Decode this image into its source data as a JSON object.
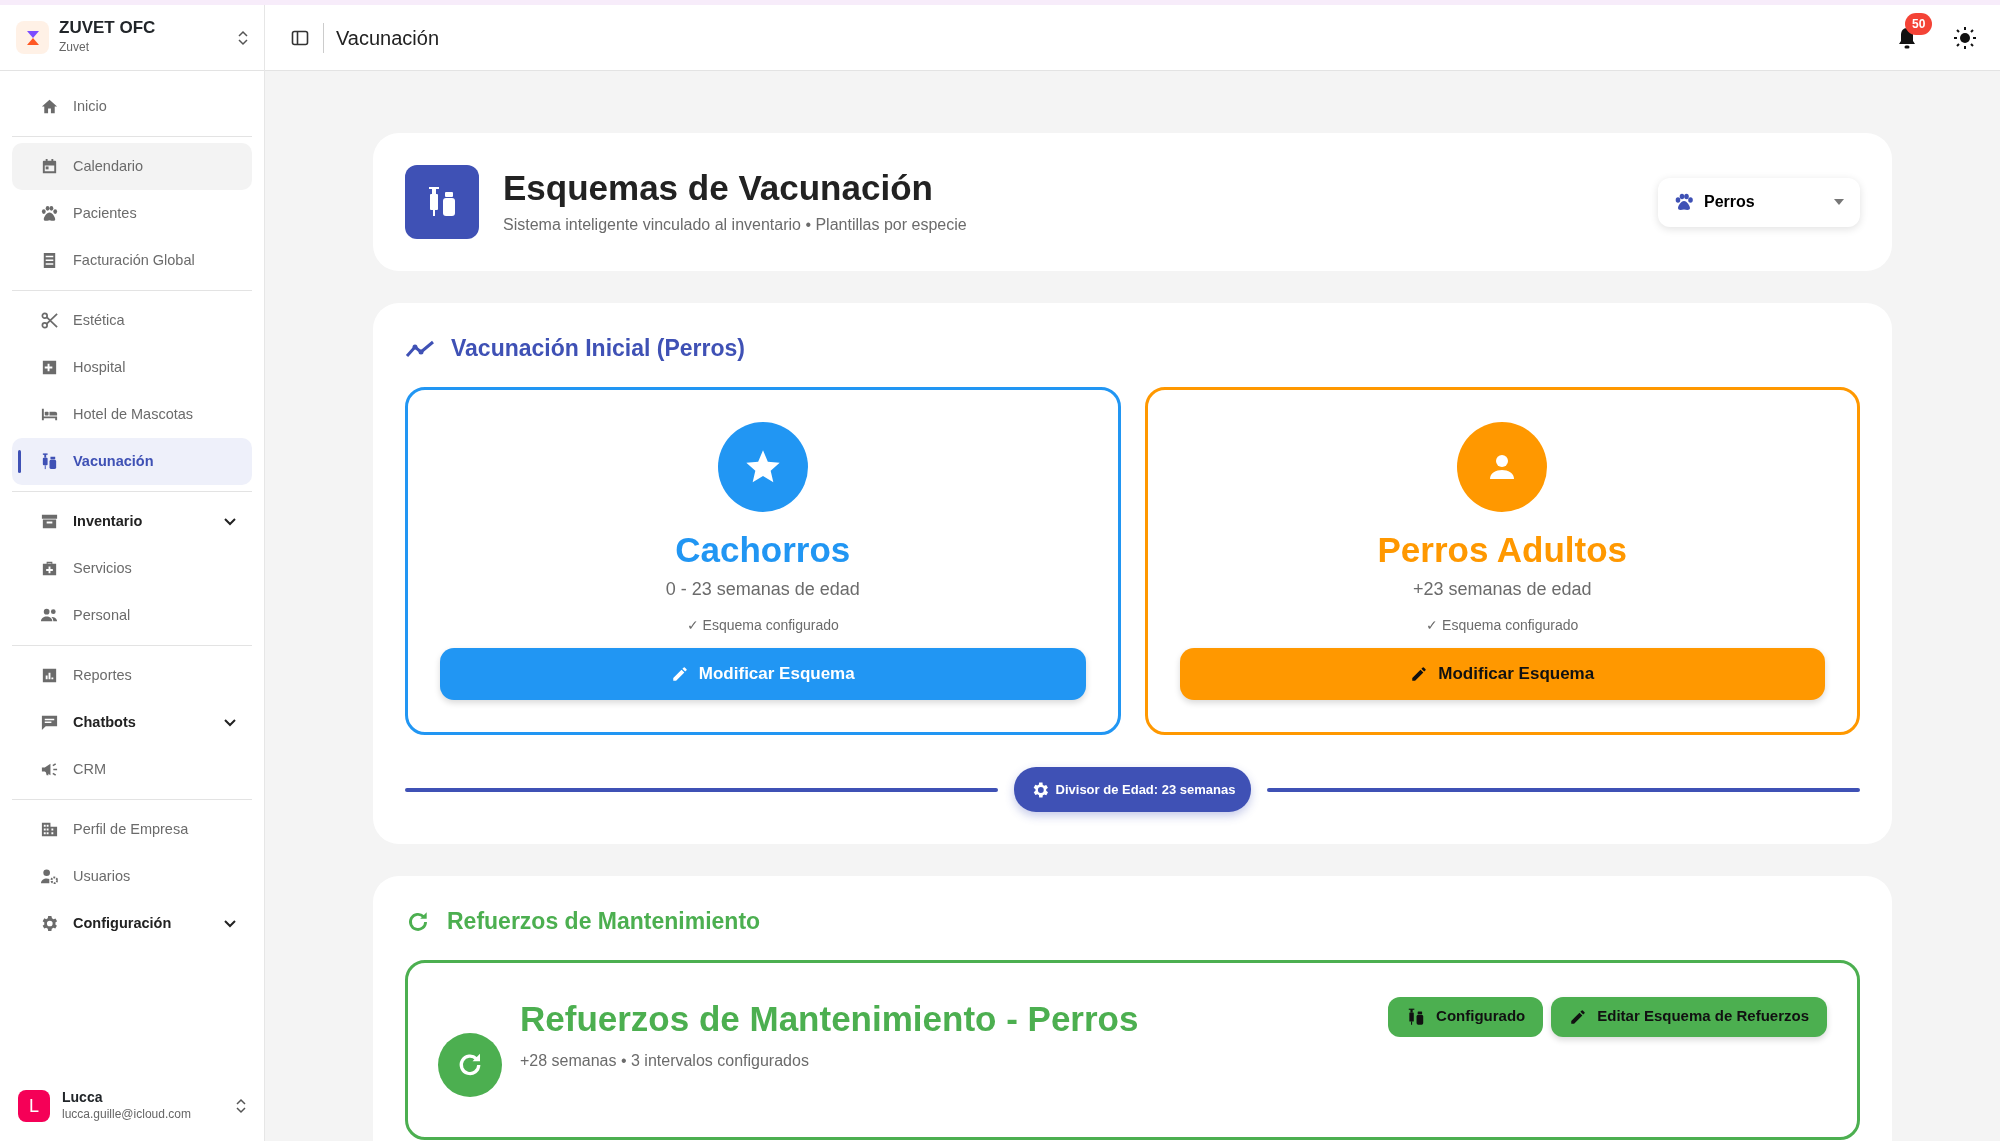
{
  "brand": {
    "name": "ZUVET OFC",
    "subtitle": "Zuvet"
  },
  "sidebar": {
    "groups": [
      [
        {
          "label": "Inicio",
          "selected": false,
          "hovered": false,
          "expandable": false
        }
      ],
      [
        {
          "label": "Calendario",
          "selected": false,
          "hovered": true,
          "expandable": false
        },
        {
          "label": "Pacientes",
          "selected": false,
          "hovered": false,
          "expandable": false
        },
        {
          "label": "Facturación Global",
          "selected": false,
          "hovered": false,
          "expandable": false
        }
      ],
      [
        {
          "label": "Estética",
          "selected": false,
          "hovered": false,
          "expandable": false
        },
        {
          "label": "Hospital",
          "selected": false,
          "hovered": false,
          "expandable": false
        },
        {
          "label": "Hotel de Mascotas",
          "selected": false,
          "hovered": false,
          "expandable": false
        },
        {
          "label": "Vacunación",
          "selected": true,
          "hovered": false,
          "expandable": false
        }
      ],
      [
        {
          "label": "Inventario",
          "selected": false,
          "hovered": false,
          "expandable": true
        },
        {
          "label": "Servicios",
          "selected": false,
          "hovered": false,
          "expandable": false
        },
        {
          "label": "Personal",
          "selected": false,
          "hovered": false,
          "expandable": false
        }
      ],
      [
        {
          "label": "Reportes",
          "selected": false,
          "hovered": false,
          "expandable": false
        },
        {
          "label": "Chatbots",
          "selected": false,
          "hovered": false,
          "expandable": true
        },
        {
          "label": "CRM",
          "selected": false,
          "hovered": false,
          "expandable": false
        }
      ],
      [
        {
          "label": "Perfil de Empresa",
          "selected": false,
          "hovered": false,
          "expandable": false
        },
        {
          "label": "Usuarios",
          "selected": false,
          "hovered": false,
          "expandable": false
        },
        {
          "label": "Configuración",
          "selected": false,
          "hovered": false,
          "expandable": true
        }
      ]
    ]
  },
  "user": {
    "initial": "L",
    "name": "Lucca",
    "email": "lucca.guille@icloud.com"
  },
  "header": {
    "title": "Vacunación",
    "notification_count": "50"
  },
  "page": {
    "title": "Esquemas de Vacunación",
    "subtitle": "Sistema inteligente vinculado al inventario • Plantillas por especie",
    "species_select": {
      "value": "Perros"
    }
  },
  "initial": {
    "title": "Vacunación Inicial (Perros)",
    "groups": [
      {
        "title": "Cachorros",
        "range": "0 - 23 semanas de edad",
        "status": "✓ Esquema configurado",
        "button": "Modificar Esquema",
        "color": "#2196f3"
      },
      {
        "title": "Perros Adultos",
        "range": "+23 semanas de edad",
        "status": "✓ Esquema configurado",
        "button": "Modificar Esquema",
        "color": "#ff9800"
      }
    ],
    "divider": "Divisor de Edad: 23 semanas"
  },
  "boosters": {
    "title": "Refuerzos de Mantenimiento",
    "card": {
      "title": "Refuerzos de Mantenimiento - Perros",
      "subtitle": "+28 semanas • 3 intervalos configurados",
      "status": "Configurado",
      "button": "Editar Esquema de Refuerzos"
    }
  }
}
